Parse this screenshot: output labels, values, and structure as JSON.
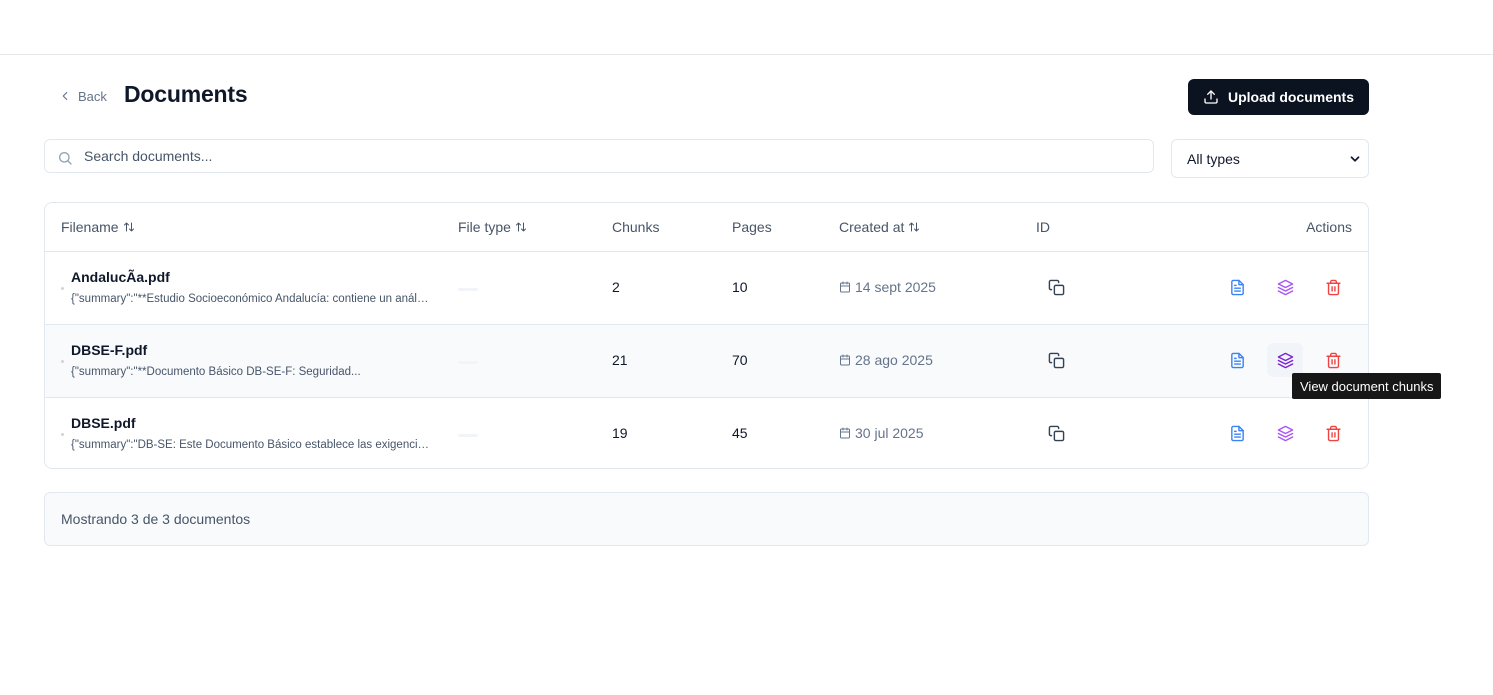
{
  "header": {
    "back_label": "Back",
    "title": "Documents",
    "upload_label": "Upload documents"
  },
  "search": {
    "placeholder": "Search documents..."
  },
  "filter": {
    "selected": "All types"
  },
  "table": {
    "columns": {
      "filename": "Filename",
      "file_type": "File type",
      "chunks": "Chunks",
      "pages": "Pages",
      "created_at": "Created at",
      "id": "ID",
      "actions": "Actions"
    },
    "rows": [
      {
        "filename": "AndalucÃa.pdf",
        "summary": "{\"summary\":\"**Estudio Socioeconómico Andalucía: contiene un análisis detallado de la situación económica",
        "chunks": "2",
        "pages": "10",
        "created": "14 sept 2025"
      },
      {
        "filename": "DBSE-F.pdf",
        "summary": "{\"summary\":\"**Documento Básico DB-SE-F: Seguridad...",
        "chunks": "21",
        "pages": "70",
        "created": "28 ago 2025"
      },
      {
        "filename": "DBSE.pdf",
        "summary": "{\"summary\":\"DB-SE: Este Documento Básico establece las exigencias básicas de seguridad estructural",
        "chunks": "19",
        "pages": "45",
        "created": "30 jul 2025"
      }
    ]
  },
  "tooltip": {
    "text": "View document chunks"
  },
  "footer": {
    "summary": "Mostrando 3 de 3 documentos"
  },
  "icons": {
    "back": "chevron-left-icon",
    "upload": "upload-icon",
    "search": "search-icon",
    "select": "chevron-down-icon",
    "sort": "arrow-up-down-icon",
    "date": "calendar-icon",
    "copy": "copy-icon",
    "view_document": "file-text-icon",
    "view_chunks": "layers-icon",
    "delete": "trash-icon"
  },
  "colors": {
    "primary_button": "#0b1220",
    "view_document": "#3b82f6",
    "view_chunks": "#a855f7",
    "delete": "#ef4444",
    "tooltip_bg": "#171717"
  }
}
